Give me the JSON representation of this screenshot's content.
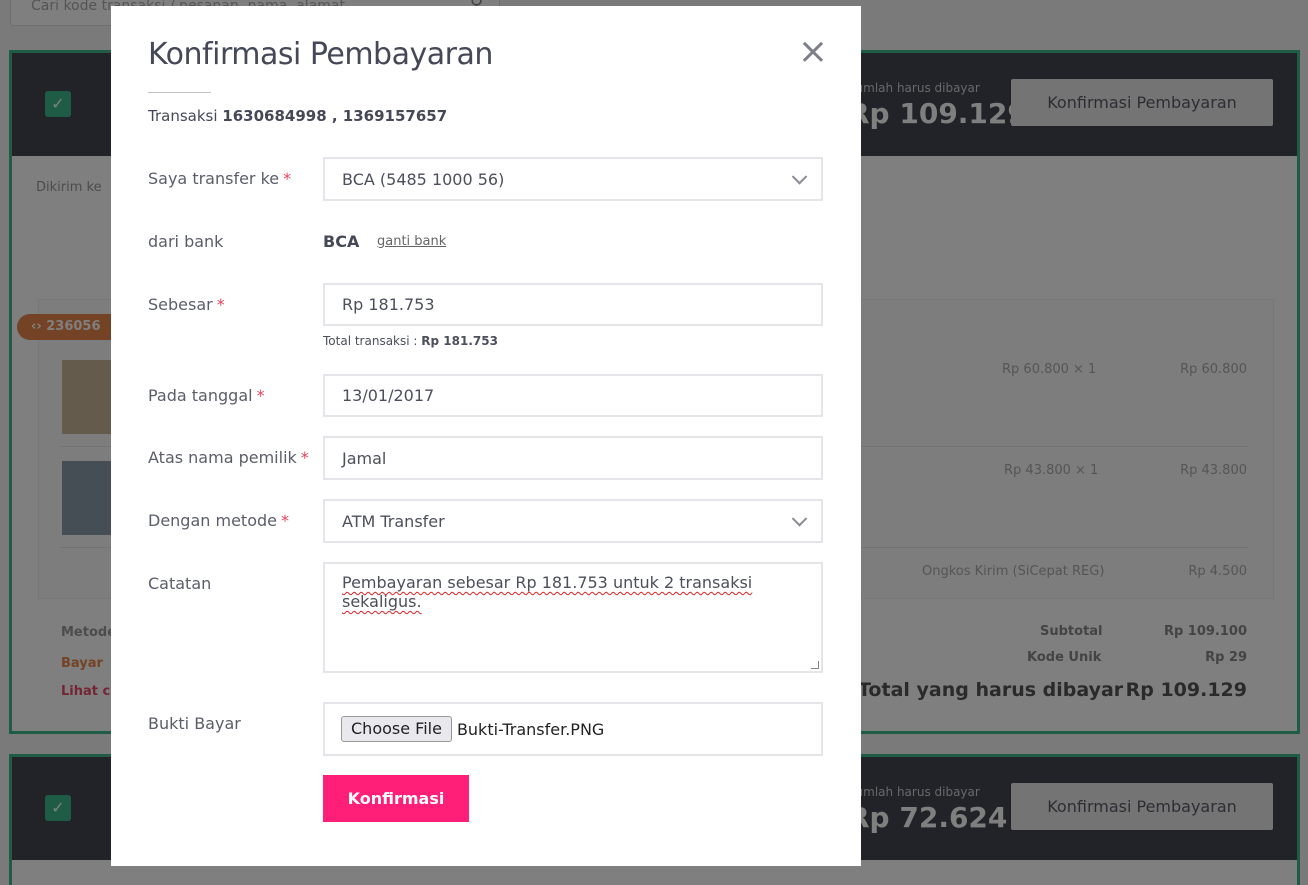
{
  "background": {
    "search_placeholder": "Cari kode transaksi / pesanan, nama, alamat",
    "orders": [
      {
        "amount_label": "Jumlah harus dibayar",
        "amount_value": "Rp 109.129",
        "confirm_label": "Konfirmasi Pembayaran",
        "shipping_to_label": "Dikirim ke",
        "invoice_tag": "236056",
        "items": [
          {
            "price_qty": "Rp 60.800  × 1",
            "total": "Rp 60.800"
          },
          {
            "price_qty": "Rp 43.800  × 1",
            "total": "Rp 43.800"
          }
        ],
        "shipping_label": "Ongkos Kirim (SiCepat REG)",
        "shipping_value": "Rp 4.500",
        "subtotal_label": "Subtotal",
        "subtotal_value": "Rp 109.100",
        "unique_code_label": "Kode Unik",
        "unique_code_value": "Rp 29",
        "grand_total_label": "Total yang harus dibayar",
        "grand_total_value": "Rp 109.129",
        "method_label": "Metode",
        "pay_label": "Bayar",
        "view_label": "Lihat ca"
      },
      {
        "amount_label": "Jumlah harus dibayar",
        "amount_value": "Rp 72.624",
        "confirm_label": "Konfirmasi Pembayaran"
      }
    ]
  },
  "modal": {
    "title": "Konfirmasi Pembayaran",
    "transaction_prefix": "Transaksi",
    "transaction_ids": "1630684998 , 1369157657",
    "fields": {
      "transfer_to": {
        "label": "Saya transfer ke",
        "value": "BCA (5485 1000 56)"
      },
      "from_bank": {
        "label": "dari bank",
        "value": "BCA",
        "change_link": "ganti bank"
      },
      "amount": {
        "label": "Sebesar",
        "value": "Rp 181.753",
        "note_prefix": "Total transaksi :",
        "note_value": "Rp 181.753"
      },
      "date": {
        "label": "Pada tanggal",
        "value": "13/01/2017"
      },
      "account_name": {
        "label": "Atas nama pemilik",
        "value": "Jamal"
      },
      "method": {
        "label": "Dengan metode",
        "value": "ATM Transfer"
      },
      "notes": {
        "label": "Catatan",
        "value": "Pembayaran sebesar Rp 181.753 untuk 2 transaksi sekaligus."
      },
      "proof": {
        "label": "Bukti Bayar",
        "button": "Choose File",
        "file_name": "Bukti-Transfer.PNG"
      }
    },
    "required_mark": "*",
    "close_glyph": "×",
    "submit_label": "Konfirmasi",
    "colors": {
      "accent": "#ff1f78",
      "required": "#e9425a",
      "header_dark": "#434651",
      "success": "#3fb98a"
    }
  }
}
